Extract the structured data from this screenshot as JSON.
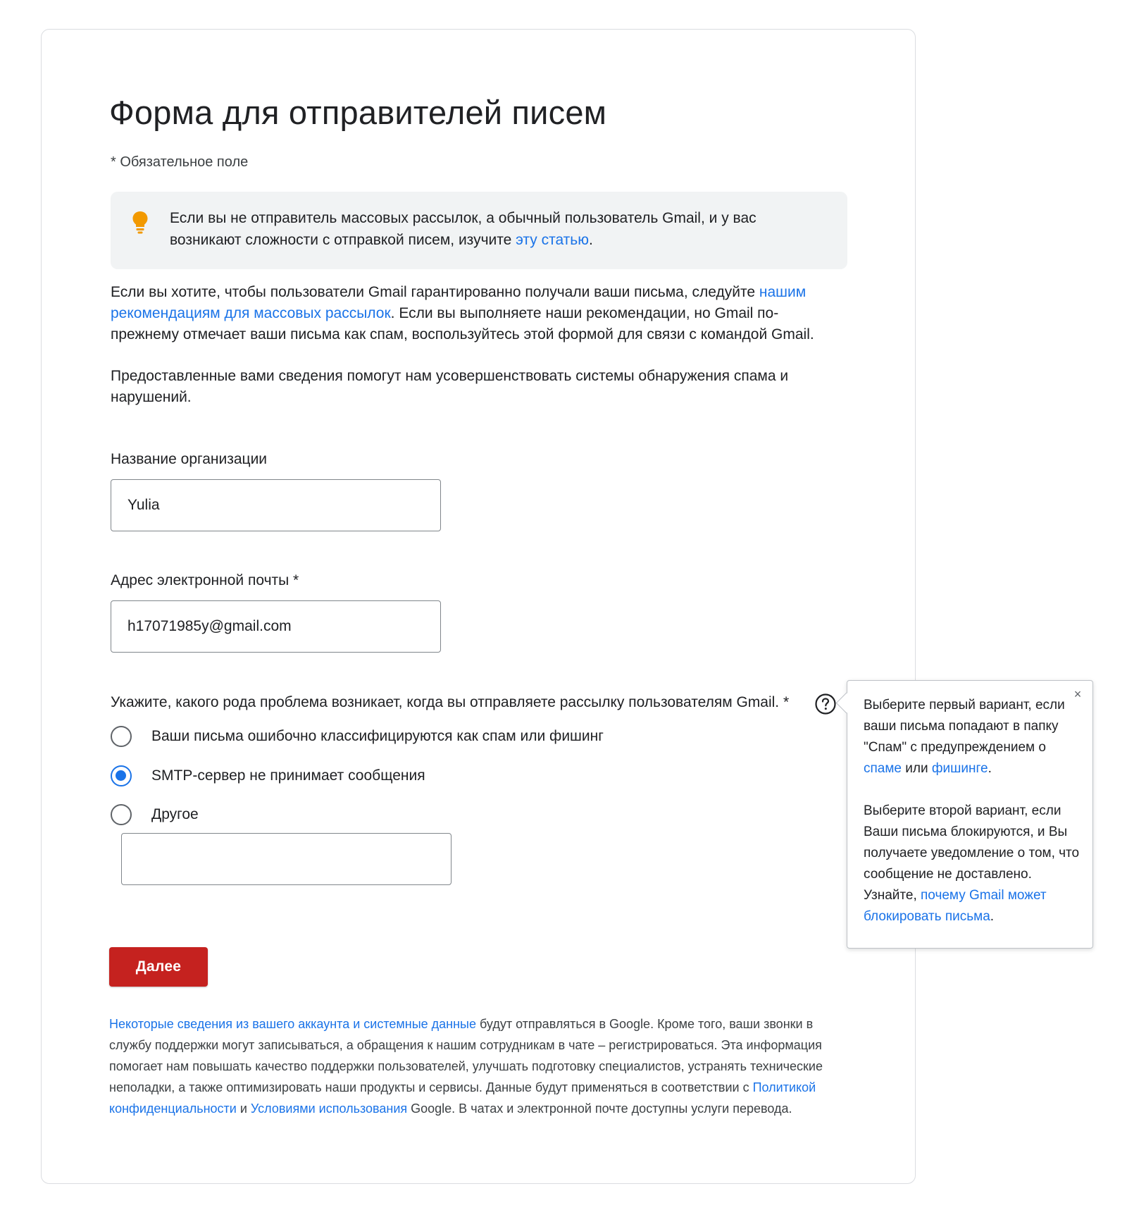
{
  "page": {
    "title": "Форма для отправителей писем",
    "required_note": "* Обязательное поле"
  },
  "notice": {
    "icon": "lightbulb-icon",
    "text_before": "Если вы не отправитель массовых рассылок, а обычный пользователь Gmail, и у вас возникают сложности с отправкой писем, изучите ",
    "link": "эту статью",
    "text_after": "."
  },
  "intro": {
    "p1_before": "Если вы хотите, чтобы пользователи Gmail гарантированно получали ваши письма, следуйте ",
    "p1_link": "нашим рекомендациям для массовых рассылок",
    "p1_after": ". Если вы выполняете наши рекомендации, но Gmail по-прежнему отмечает ваши письма как спам, воспользуйтесь этой формой для связи с командой Gmail.",
    "p2": "Предоставленные вами сведения помогут нам усовершенствовать системы обнаружения спама и нарушений."
  },
  "form": {
    "org_label": "Название организации",
    "org_value": "Yulia",
    "email_label": "Адрес электронной почты *",
    "email_value": "h17071985y@gmail.com",
    "question": "Укажите, какого рода проблема возникает, когда вы отправляете рассылку пользователям Gmail. *",
    "options": [
      {
        "label": "Ваши письма ошибочно классифицируются как спам или фишинг",
        "checked": false
      },
      {
        "label": "SMTP-сервер не принимает сообщения",
        "checked": true
      },
      {
        "label": "Другое",
        "checked": false
      }
    ],
    "other_value": "",
    "next_label": "Далее"
  },
  "tooltip": {
    "close": "×",
    "p1_before": "Выберите первый вариант, если ваши письма попадают в папку \"Спам\" с предупреждением о ",
    "p1_link1": "спаме",
    "p1_mid": " или ",
    "p1_link2": "фишинге",
    "p1_after": ".",
    "p2_before": "Выберите второй вариант, если Ваши письма блокируются, и Вы получаете уведомление о том, что сообщение не доставлено. Узнайте, ",
    "p2_link": "почему Gmail может блокировать письма",
    "p2_after": "."
  },
  "footer": {
    "link1": "Некоторые сведения из вашего аккаунта и системные данные",
    "text1": " будут отправляться в Google. Кроме того, ваши звонки в службу поддержки могут записываться, а обращения к нашим сотрудникам в чате – регистрироваться. Эта информация помогает нам повышать качество поддержки пользователей, улучшать подготовку специалистов, устранять технические неполадки, а также оптимизировать наши продукты и сервисы. Данные будут применяться в соответствии с ",
    "link2": "Политикой конфиденциальности",
    "text2": " и ",
    "link3": "Условиями использования",
    "text3": " Google. В чатах и электронной почте доступны услуги перевода."
  },
  "colors": {
    "link": "#1a73e8",
    "button": "#c5221f",
    "notice_bg": "#f1f3f4",
    "bulb": "#f29900"
  }
}
